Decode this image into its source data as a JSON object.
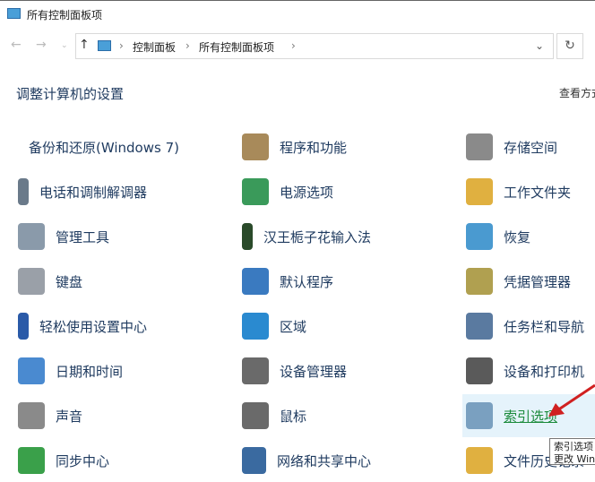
{
  "window": {
    "title": "所有控制面板项"
  },
  "address": {
    "crumbs": [
      "控制面板",
      "所有控制面板项"
    ]
  },
  "heading": "调整计算机的设置",
  "view_by": "查看方式",
  "columns": [
    [
      "备份和还原(Windows 7)",
      "电话和调制解调器",
      "管理工具",
      "键盘",
      "轻松使用设置中心",
      "日期和时间",
      "声音",
      "同步中心"
    ],
    [
      "程序和功能",
      "电源选项",
      "汉王栀子花输入法",
      "默认程序",
      "区域",
      "设备管理器",
      "鼠标",
      "网络和共享中心"
    ],
    [
      "存储空间",
      "工作文件夹",
      "恢复",
      "凭据管理器",
      "任务栏和导航",
      "设备和打印机",
      "索引选项",
      "文件历史记录"
    ]
  ],
  "icon_colors": [
    [
      "#3a9a3a",
      "#6a7a8a",
      "#8a9aaa",
      "#9aa0a8",
      "#2a5aa8",
      "#4a8ad0",
      "#8a8a8a",
      "#3aa04a"
    ],
    [
      "#a88a5a",
      "#3a9a5a",
      "#2a4a2a",
      "#3a7ac0",
      "#2a8ad0",
      "#6a6a6a",
      "#6a6a6a",
      "#3a6aa0"
    ],
    [
      "#8a8a8a",
      "#e0b040",
      "#4a9ad0",
      "#b0a050",
      "#5a7aa0",
      "#5a5a5a",
      "#7aa0c0",
      "#e0b040"
    ]
  ],
  "tooltip": {
    "title": "索引选项",
    "desc": "更改 Windows 索引"
  }
}
